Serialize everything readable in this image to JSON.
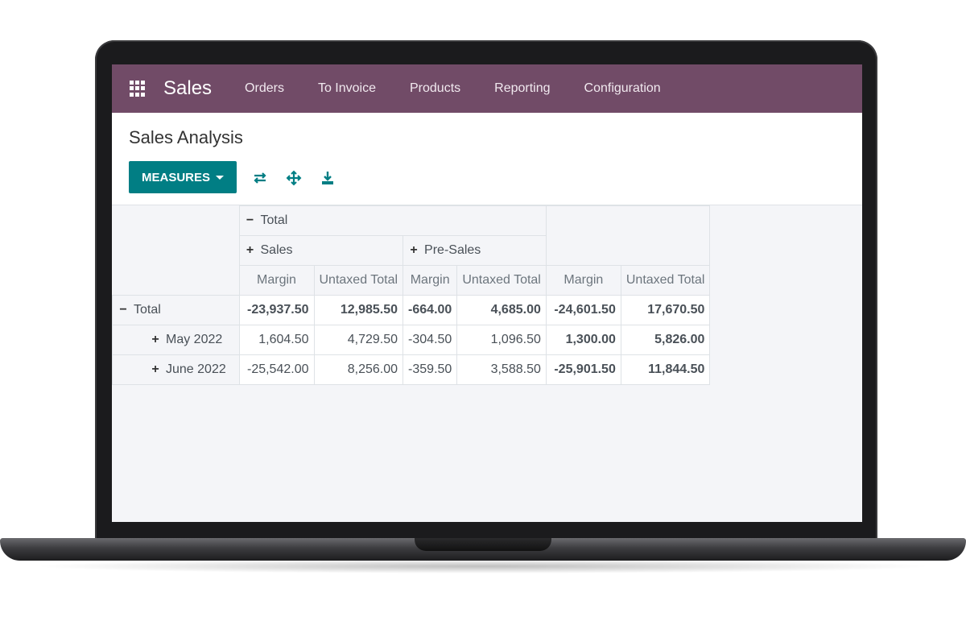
{
  "navbar": {
    "apps_icon": "apps-grid-icon",
    "app_title": "Sales",
    "menu": [
      "Orders",
      "To Invoice",
      "Products",
      "Reporting",
      "Configuration"
    ]
  },
  "control": {
    "page_title": "Sales Analysis",
    "measures_label": "MEASURES",
    "tools": [
      "flip-axis-icon",
      "expand-all-icon",
      "download-icon"
    ]
  },
  "pivot": {
    "col_group": "Total",
    "col_subgroups": [
      "Sales",
      "Pre-Sales"
    ],
    "measures": [
      "Margin",
      "Untaxed Total",
      "Margin",
      "Untaxed Total",
      "Margin",
      "Untaxed Total"
    ],
    "rows": [
      {
        "label": "Total",
        "sign": "−",
        "values": [
          "-23,937.50",
          "12,985.50",
          "-664.00",
          "4,685.00",
          "-24,601.50",
          "17,670.50"
        ]
      },
      {
        "label": "May 2022",
        "sign": "+",
        "values": [
          "1,604.50",
          "4,729.50",
          "-304.50",
          "1,096.50",
          "1,300.00",
          "5,826.00"
        ]
      },
      {
        "label": "June 2022",
        "sign": "+",
        "values": [
          "-25,542.00",
          "8,256.00",
          "-359.50",
          "3,588.50",
          "-25,901.50",
          "11,844.50"
        ]
      }
    ]
  },
  "colors": {
    "navbar": "#714b67",
    "primary": "#017e84"
  }
}
